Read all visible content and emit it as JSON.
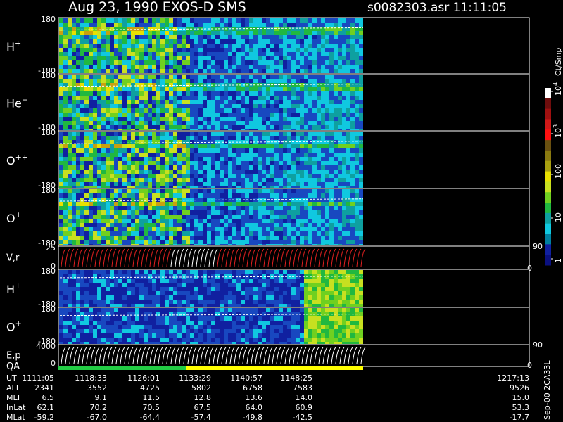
{
  "header": {
    "title": "Aug 23, 1990   EXOS-D SMS",
    "file_time": "s0082303.asr  11:11:05"
  },
  "colorbar": {
    "unit": "Ct/Smp",
    "ticks": [
      {
        "base": "10",
        "exp": "4"
      },
      {
        "base": "10",
        "exp": "3"
      },
      {
        "base": "100",
        "exp": ""
      },
      {
        "base": "10",
        "exp": ""
      },
      {
        "base": "1",
        "exp": ""
      }
    ],
    "colors": [
      "#ffffff",
      "#6e0d0d",
      "#a01010",
      "#d01818",
      "#ff1010",
      "#6a5010",
      "#8a7a10",
      "#a8a010",
      "#e8e000",
      "#c8e020",
      "#70d020",
      "#20b840",
      "#0ea0a0",
      "#10c8e0",
      "#0080a0",
      "#1020a0",
      "#0a1080"
    ]
  },
  "chart_data": [
    {
      "type": "heatmap",
      "name": "H+",
      "ylim": [
        -180,
        180
      ],
      "y_ticks": [
        "180",
        "-180"
      ],
      "label_base": "H",
      "label_sup": "+"
    },
    {
      "type": "heatmap",
      "name": "He+",
      "ylim": [
        -180,
        180
      ],
      "y_ticks": [
        "180",
        "-180"
      ],
      "label_base": "He",
      "label_sup": "+"
    },
    {
      "type": "heatmap",
      "name": "O++",
      "ylim": [
        -180,
        180
      ],
      "y_ticks": [
        "180",
        "-180"
      ],
      "label_base": "O",
      "label_sup": "++"
    },
    {
      "type": "heatmap",
      "name": "O+",
      "ylim": [
        -180,
        180
      ],
      "y_ticks": [
        "180",
        "-180"
      ],
      "label_base": "O",
      "label_sup": "+"
    },
    {
      "type": "line",
      "name": "V,r",
      "ylim": [
        0,
        25
      ],
      "y_ticks": [
        "25",
        "0"
      ],
      "right_ticks": [
        "90",
        "0"
      ],
      "label_base": "V,r",
      "label_sup": ""
    },
    {
      "type": "heatmap",
      "name": "H+",
      "ylim": [
        -180,
        180
      ],
      "y_ticks": [
        "180",
        "-180"
      ],
      "label_base": "H",
      "label_sup": "+"
    },
    {
      "type": "heatmap",
      "name": "O+",
      "ylim": [
        -180,
        180
      ],
      "y_ticks": [
        "180",
        "-180"
      ],
      "label_base": "O",
      "label_sup": "+"
    },
    {
      "type": "line",
      "name": "E,p",
      "ylim": [
        0,
        4000
      ],
      "y_ticks": [
        "4000",
        "0"
      ],
      "right_ticks": [
        "90",
        "0"
      ],
      "label_base": "E,p",
      "label_sup": ""
    }
  ],
  "qa_label": "QA",
  "qa_segments": [
    {
      "color": "#22cc44",
      "fraction": 0.42
    },
    {
      "color": "#ffff00",
      "fraction": 0.58
    }
  ],
  "footer": {
    "labels": [
      "UT",
      "ALT",
      "MLT",
      "InLat",
      "MLat"
    ],
    "columns": [
      {
        "UT": "1111:05",
        "ALT": "2341",
        "MLT": "6.5",
        "InLat": "62.1",
        "MLat": "-59.2"
      },
      {
        "UT": "1118:33",
        "ALT": "3552",
        "MLT": "9.1",
        "InLat": "70.2",
        "MLat": "-67.0"
      },
      {
        "UT": "1126:01",
        "ALT": "4725",
        "MLT": "11.5",
        "InLat": "70.5",
        "MLat": "-64.4"
      },
      {
        "UT": "1133:29",
        "ALT": "5802",
        "MLT": "12.8",
        "InLat": "67.5",
        "MLat": "-57.4"
      },
      {
        "UT": "1140:57",
        "ALT": "6758",
        "MLT": "13.6",
        "InLat": "64.0",
        "MLat": "-49.8"
      },
      {
        "UT": "1148:25",
        "ALT": "7583",
        "MLT": "14.0",
        "InLat": "60.9",
        "MLat": "-42.5"
      },
      {
        "UT": "1217:13",
        "ALT": "9526",
        "MLT": "15.0",
        "InLat": "53.3",
        "MLat": "-17.7"
      }
    ],
    "version": "Sep-00  2CA33L"
  }
}
